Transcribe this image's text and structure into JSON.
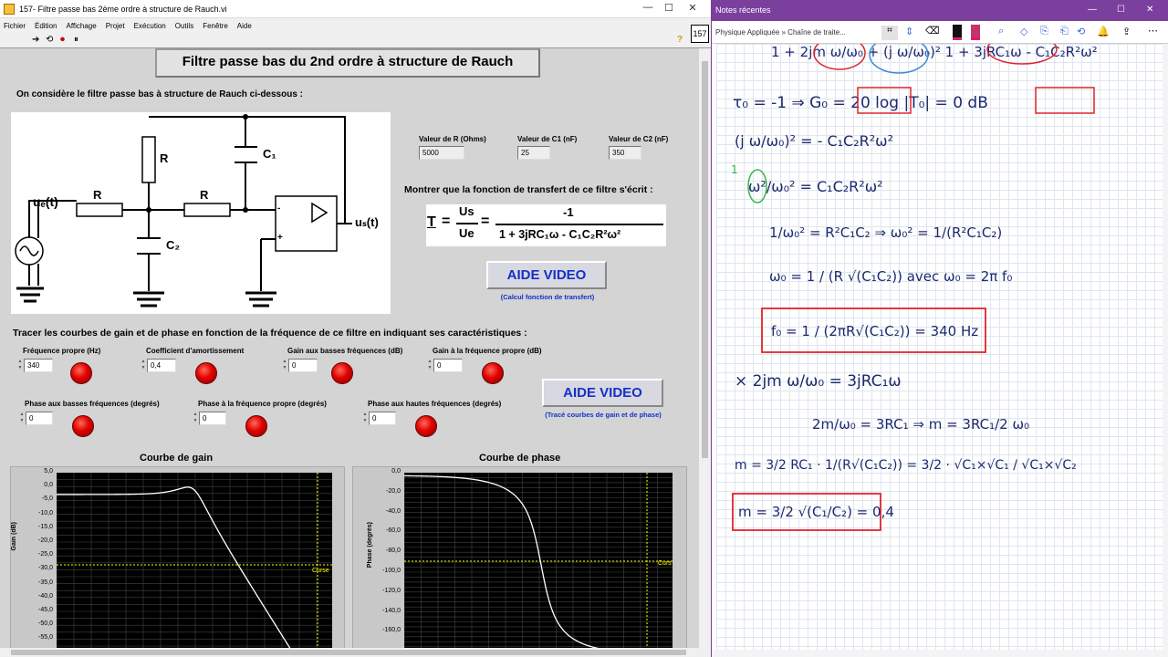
{
  "labview": {
    "window_title": "157- Filtre passe bas 2ème ordre à structure de Rauch.vi",
    "vi_number": "157",
    "menu": [
      "Fichier",
      "Édition",
      "Affichage",
      "Projet",
      "Exécution",
      "Outils",
      "Fenêtre",
      "Aide"
    ],
    "panel_title": "Filtre passe bas du 2nd ordre à structure de Rauch",
    "intro": "On considère le filtre passe bas à structure de Rauch ci-dessous :",
    "circuit": {
      "R1": "R",
      "R2": "R",
      "R3": "R",
      "C1": "C₁",
      "C2": "C₂",
      "ue": "uₑ(t)",
      "us": "uₛ(t)",
      "minus": "-",
      "plus": "+"
    },
    "inputs": {
      "R": {
        "label": "Valeur de R (Ohms)",
        "value": "5000"
      },
      "C1": {
        "label": "Valeur de C1 (nF)",
        "value": "25"
      },
      "C2": {
        "label": "Valeur de C2 (nF)",
        "value": "350"
      }
    },
    "montrer": "Montrer que la fonction de transfert de ce filtre s'écrit :",
    "formula": {
      "T": "T",
      "eq1": "=",
      "us": "Us",
      "ue": "Ue",
      "eq2": "=",
      "num": "-1",
      "den": "1 + 3jRC₁ω - C₁C₂R²ω²"
    },
    "aide1": {
      "label": "AIDE VIDEO",
      "note": "(Calcul fonction de transfert)"
    },
    "tracer": "Tracer les courbes de gain et de phase en fonction de la fréquence de ce filtre en indiquant ses caractéristiques  :",
    "fields_row1": [
      {
        "label": "Fréquence propre (Hz)",
        "value": "340"
      },
      {
        "label": "Coefficient d'amortissement",
        "value": "0,4"
      },
      {
        "label": "Gain aux basses fréquences (dB)",
        "value": "0"
      },
      {
        "label": "Gain à la fréquence propre (dB)",
        "value": "0"
      }
    ],
    "fields_row2": [
      {
        "label": "Phase aux basses fréquences (degrés)",
        "value": "0"
      },
      {
        "label": "Phase à la fréquence propre (degrés)",
        "value": "0"
      },
      {
        "label": "Phase aux hautes fréquences (degrés)",
        "value": "0"
      }
    ],
    "aide2": {
      "label": "AIDE VIDEO",
      "note": "(Tracé courbes de gain et de phase)"
    },
    "gain_graph": {
      "title": "Courbe de gain",
      "ylabel": "Gain (dB)",
      "cursor": "Curse",
      "yticks": [
        "5,0",
        "0,0",
        "-5,0",
        "-10,0",
        "-15,0",
        "-20,0",
        "-25,0",
        "-30,0",
        "-35,0",
        "-40,0",
        "-45,0",
        "-50,0",
        "-55,0"
      ]
    },
    "phase_graph": {
      "title": "Courbe de phase",
      "ylabel": "Phase (degrés)",
      "cursor": "Curs",
      "yticks": [
        "0,0",
        "-20,0",
        "-40,0",
        "-60,0",
        "-80,0",
        "-100,0",
        "-120,0",
        "-140,0",
        "-160,0"
      ]
    }
  },
  "onenote": {
    "title": "Notes récentes",
    "breadcrumb": "Physique Appliquée » Chaîne de traite...",
    "window_controls": [
      "—",
      "☐",
      "✕"
    ],
    "notes": {
      "l1": "τ₀ = -1  ⇒  G₀ = 20 log |T₀| = 0 dB",
      "l2": "(j ω/ω₀)² = - C₁C₂R²ω²",
      "l3": "ω²/ω₀² = C₁C₂R²ω²",
      "l4a": "1/ω₀² = R²C₁C₂  ⇒  ω₀² = 1/(R²C₁C₂)",
      "l5": "ω₀ = 1 / (R √(C₁C₂))   avec ω₀ = 2π f₀",
      "l6": "f₀ = 1 / (2πR√(C₁C₂)) = 340 Hz",
      "l7": "× 2jm ω/ω₀ = 3jRC₁ω",
      "l8": "2m/ω₀ = 3RC₁  ⇒  m = 3RC₁/2 ω₀",
      "l9": "m = 3/2 RC₁ · 1/(R√(C₁C₂)) = 3/2 · √C₁×√C₁ / √C₁×√C₂",
      "l10": "m = 3/2 √(C₁/C₂) = 0,4",
      "top": "1 + 2jm ω/ω₀ + (j ω/ω₀)²     1 + 3jRC₁ω - C₁C₂R²ω²"
    }
  },
  "colors": {
    "accent_red": "#e1242c",
    "onenote_purple": "#7b3f9e",
    "ink": "#1c2a6e",
    "check": "#3ab54a"
  }
}
